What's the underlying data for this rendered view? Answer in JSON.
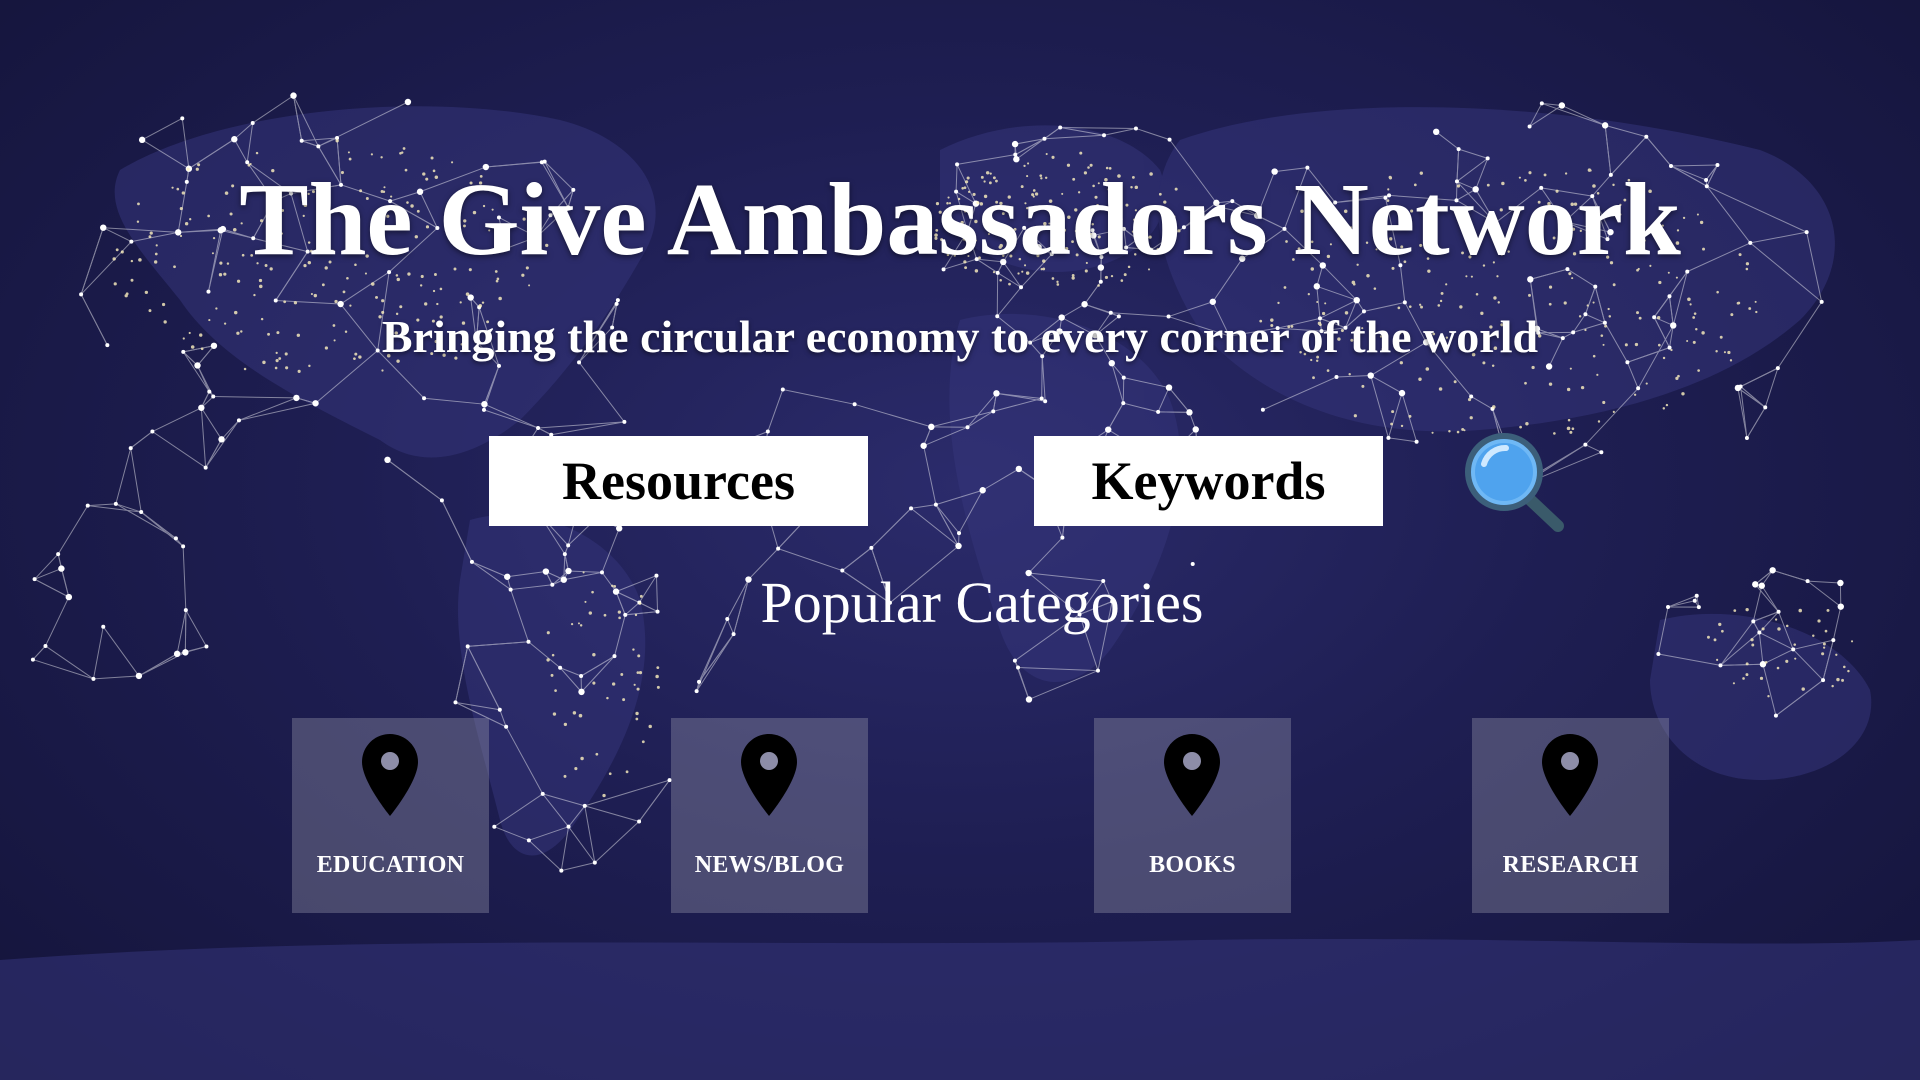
{
  "hero": {
    "title": "The Give Ambassadors Network",
    "subtitle": "Bringing the circular economy to every corner of the world"
  },
  "actions": {
    "resources_label": "Resources",
    "keywords_label": "Keywords",
    "search_icon": "magnifying-glass-icon"
  },
  "categories": {
    "heading": "Popular Categories",
    "items": [
      {
        "label": "EDUCATION",
        "icon": "map-pin-icon"
      },
      {
        "label": "NEWS/BLOG",
        "icon": "map-pin-icon"
      },
      {
        "label": "BOOKS",
        "icon": "map-pin-icon"
      },
      {
        "label": "RESEARCH",
        "icon": "map-pin-icon"
      }
    ]
  },
  "theme": {
    "background": "#1e1e52",
    "button_bg": "#ffffff",
    "button_text": "#000000",
    "card_bg": "#8a8aa6",
    "search_accent": "#5aaaf0"
  }
}
